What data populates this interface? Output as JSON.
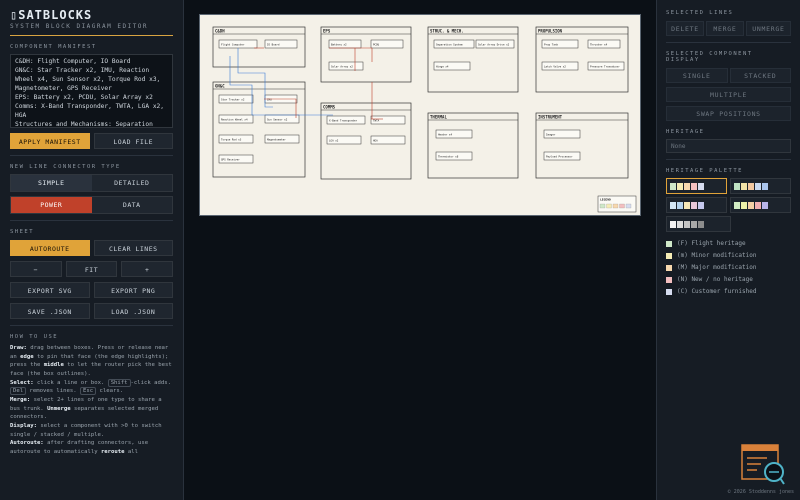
{
  "app": {
    "title": "SATBLOCKS",
    "title_glyph": "▯",
    "subtitle": "SYSTEM BLOCK DIAGRAM EDITOR"
  },
  "manifest": {
    "header": "COMPONENT MANIFEST",
    "text": "C&DH: Flight Computer, IO Board\nGN&C: Star Tracker x2, IMU, Reaction Wheel x4, Sun Sensor x2, Torque Rod x3, Magnetometer, GPS Receiver\nEPS: Battery x2, PCDU, Solar Array x2\nComms: X-Band Transponder, TWTA, LGA x2, HGA\nStructures and Mechanisms: Separation",
    "apply": "APPLY MANIFEST",
    "load": "LOAD FILE"
  },
  "connector": {
    "header": "NEW LINE CONNECTOR TYPE",
    "simple": "SIMPLE",
    "detailed": "DETAILED",
    "power": "POWER",
    "data": "DATA"
  },
  "sheet": {
    "header": "SHEET",
    "autoroute": "AUTOROUTE",
    "clear": "CLEAR LINES",
    "zoom_out": "−",
    "fit": "FIT",
    "zoom_in": "+",
    "export_svg": "EXPORT SVG",
    "export_png": "EXPORT PNG",
    "save_json": "SAVE .JSON",
    "load_json": "LOAD .JSON"
  },
  "howto": {
    "header": "HOW TO USE",
    "draw_label": "Draw:",
    "draw_text_1": "drag between boxes. Press or release near an",
    "draw_edge": "edge",
    "draw_text_2": "to pin that face (the edge highlights); press the",
    "draw_middle": "middle",
    "draw_text_3": "to let the router pick the best face (the box outlines).",
    "select_label": "Select:",
    "select_text_1": "click a line or box.",
    "select_key_shift": "Shift",
    "select_text_2": "-click adds.",
    "select_key_del": "Del",
    "select_text_3": "removes lines.",
    "select_key_esc": "Esc",
    "select_text_4": "clears.",
    "merge_label": "Merge:",
    "merge_text_1": "select 2+ lines of one type to share a bus trunk.",
    "unmerge_label": "Unmerge",
    "merge_text_2": "separates selected merged connectors.",
    "display_label": "Display:",
    "display_text": "select a component with >0 to switch single / stacked / multiple.",
    "autoroute_label": "Autoroute:",
    "autoroute_text_1": "after drafting connectors, use autoroute to automatically",
    "reroute_label": "reroute",
    "autoroute_text_2": "all"
  },
  "diagram": {
    "subsystems": [
      {
        "name": "C&DH",
        "blocks": [
          "Flight Computer",
          "IO Board"
        ]
      },
      {
        "name": "EPS",
        "blocks": [
          "Battery x2",
          "PCDU",
          "Solar Array x2"
        ]
      },
      {
        "name": "STRUC. & MECH.",
        "blocks": [
          "Separation System",
          "Solar Array Drive x2",
          "Hinge x4"
        ]
      },
      {
        "name": "PROPULSION",
        "blocks": [
          "Prop Tank",
          "Thruster x4",
          "Latch Valve x2",
          "Pressure Transducer"
        ]
      },
      {
        "name": "GN&C",
        "blocks": [
          "Star Tracker x2",
          "IMU",
          "Reaction Wheel x4",
          "Sun Sensor x2",
          "Torque Rod x3",
          "Magnetometer",
          "GPS Receiver"
        ]
      },
      {
        "name": "COMMS",
        "blocks": [
          "X-Band Transponder",
          "TWTA",
          "LGA x2",
          "HGA"
        ]
      },
      {
        "name": "THERMAL",
        "blocks": [
          "Heater x4",
          "Thermistor x8"
        ]
      },
      {
        "name": "INSTRUMENT",
        "blocks": [
          "Imager",
          "Payload Processor"
        ]
      }
    ],
    "legend_title": "LEGEND"
  },
  "right": {
    "selected_lines": "SELECTED LINES",
    "delete": "DELETE",
    "merge": "MERGE",
    "unmerge": "UNMERGE",
    "selected_display": "SELECTED COMPONENT DISPLAY",
    "single": "SINGLE",
    "stacked": "STACKED",
    "multiple": "MULTIPLE",
    "swap": "SWAP POSITIONS",
    "heritage": "HERITAGE",
    "heritage_value": "None",
    "palette_header": "HERITAGE PALETTE",
    "legend": [
      {
        "label": "(F) Flight heritage",
        "color": "#cfe8c8"
      },
      {
        "label": "(m) Minor modification",
        "color": "#f5ecb5"
      },
      {
        "label": "(M) Major modification",
        "color": "#f7d8ae"
      },
      {
        "label": "(N) New / no heritage",
        "color": "#f3bfc0"
      },
      {
        "label": "(C) Customer furnished",
        "color": "#d6dcef"
      }
    ]
  },
  "footer": "© 2026 Stoddenns jones",
  "colors": {
    "accent": "#e0a339",
    "power": "#c0412a",
    "data_line": "#3a7bd5"
  }
}
